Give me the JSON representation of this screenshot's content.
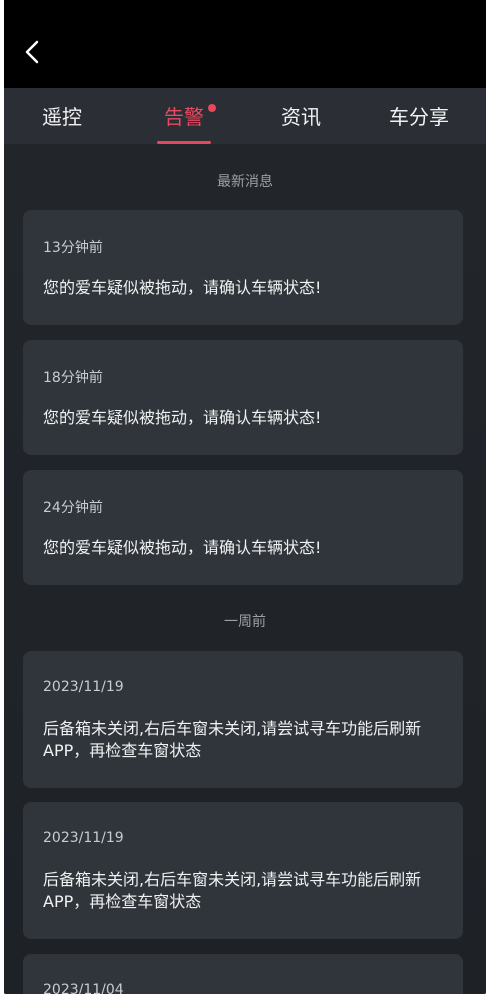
{
  "tabs": [
    {
      "label": "遥控"
    },
    {
      "label": "告警",
      "active": true,
      "has_badge": true
    },
    {
      "label": "资讯"
    },
    {
      "label": "车分享"
    }
  ],
  "sections": {
    "latest": "最新消息",
    "week": "一周前"
  },
  "latest_messages": [
    {
      "time": "13分钟前",
      "text": "您的爱车疑似被拖动，请确认车辆状态!"
    },
    {
      "time": "18分钟前",
      "text": "您的爱车疑似被拖动，请确认车辆状态!"
    },
    {
      "time": "24分钟前",
      "text": "您的爱车疑似被拖动，请确认车辆状态!"
    }
  ],
  "week_messages": [
    {
      "time": "2023/11/19",
      "text": "后备箱未关闭,右后车窗未关闭,请尝试寻车功能后刷新 APP，再检查车窗状态"
    },
    {
      "time": "2023/11/19",
      "text": "后备箱未关闭,右后车窗未关闭,请尝试寻车功能后刷新 APP，再检查车窗状态"
    },
    {
      "time": "2023/11/04",
      "text": ""
    }
  ],
  "colors": {
    "accent": "#e8485c",
    "background": "#1f2328",
    "card": "#30353b"
  },
  "icons": {
    "back": "chevron-left-icon"
  }
}
